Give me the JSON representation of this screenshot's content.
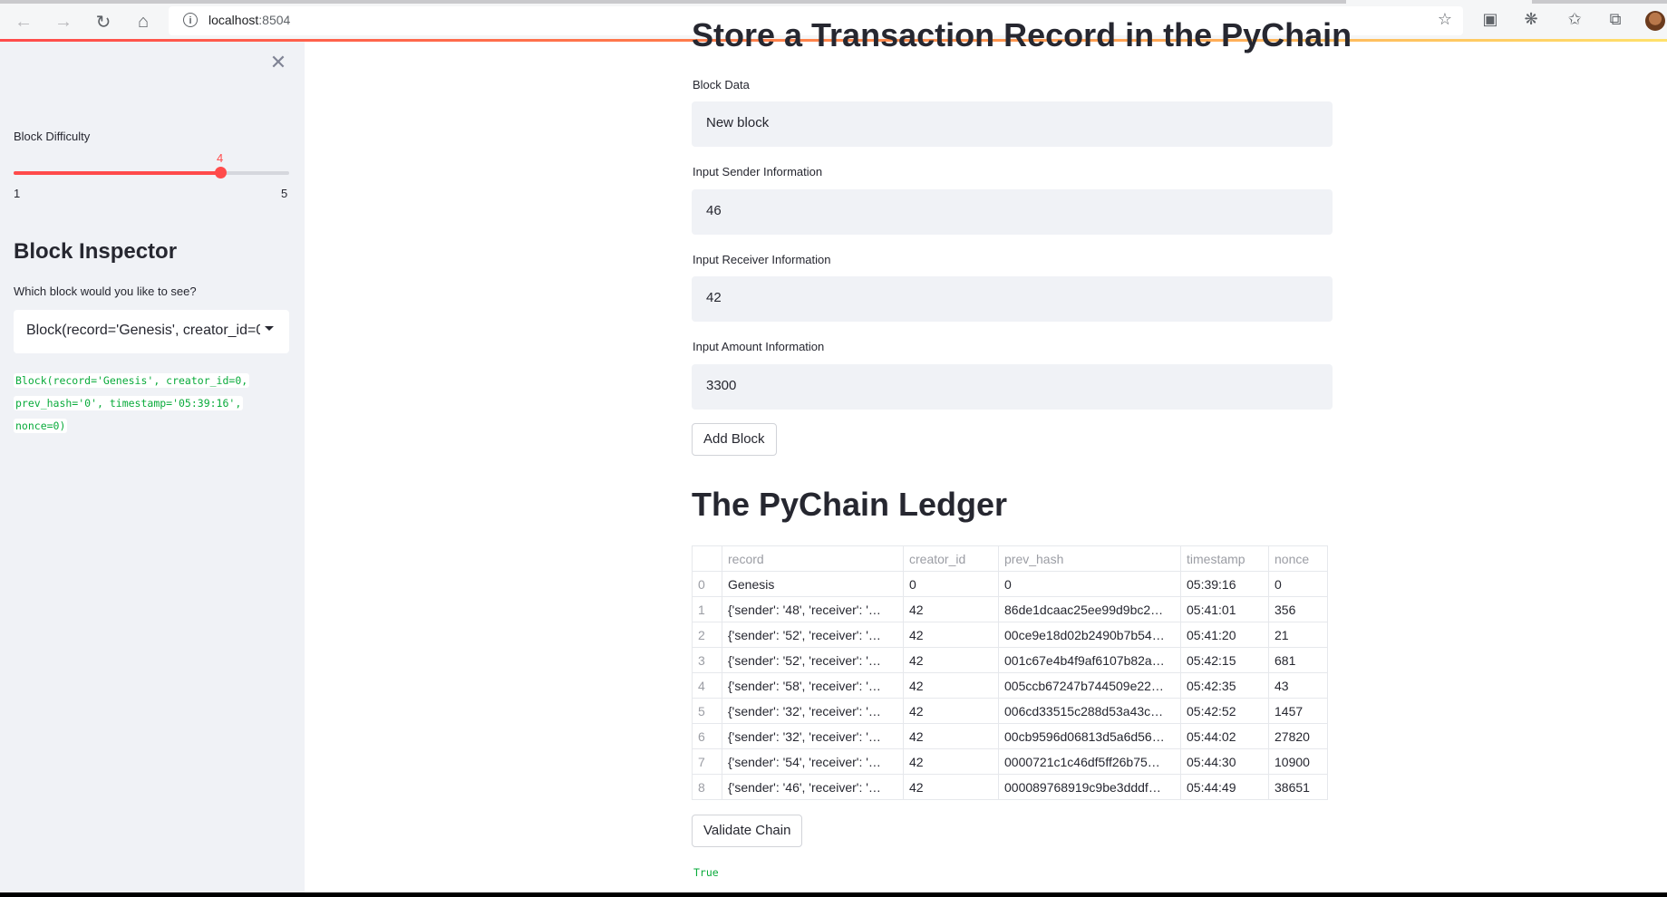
{
  "browser": {
    "url_host": "localhost",
    "url_port": ":8504",
    "icons": [
      "back-arrow-icon",
      "forward-arrow-icon",
      "reload-icon",
      "home-icon",
      "info-icon",
      "favorite-star-icon",
      "extension-icon",
      "puzzle-icon",
      "favorites-icon",
      "collections-icon",
      "profile-avatar"
    ]
  },
  "sidebar": {
    "difficulty_label": "Block Difficulty",
    "difficulty_value": "4",
    "difficulty_min": "1",
    "difficulty_max": "5",
    "difficulty_fraction": 0.75,
    "inspector_title": "Block Inspector",
    "inspector_question": "Which block would you like to see?",
    "selected_block": "Block(record='Genesis', creator_id=0, prev_hash='0', timestamp='05:39:16', nonce=0)",
    "block_code_lines": [
      "Block(record='Genesis', creator_id=0,",
      "prev_hash='0', timestamp='05:39:16',",
      "nonce=0)"
    ]
  },
  "main": {
    "form_title": "Store a Transaction Record in the PyChain",
    "fields": [
      {
        "label": "Block Data",
        "value": "New block"
      },
      {
        "label": "Input Sender Information",
        "value": "46"
      },
      {
        "label": "Input Receiver Information",
        "value": "42"
      },
      {
        "label": "Input Amount Information",
        "value": "3300"
      }
    ],
    "add_block_label": "Add Block",
    "ledger_title": "The PyChain Ledger",
    "ledger": {
      "columns": [
        "",
        "record",
        "creator_id",
        "prev_hash",
        "timestamp",
        "nonce"
      ],
      "rows": [
        [
          "0",
          "Genesis",
          "0",
          "0",
          "05:39:16",
          "0"
        ],
        [
          "1",
          "{'sender': '48', 'receiver': '…",
          "42",
          "86de1dcaac25ee99d9bc2…",
          "05:41:01",
          "356"
        ],
        [
          "2",
          "{'sender': '52', 'receiver': '…",
          "42",
          "00ce9e18d02b2490b7b54…",
          "05:41:20",
          "21"
        ],
        [
          "3",
          "{'sender': '52', 'receiver': '…",
          "42",
          "001c67e4b4f9af6107b82a…",
          "05:42:15",
          "681"
        ],
        [
          "4",
          "{'sender': '58', 'receiver': '…",
          "42",
          "005ccb67247b744509e22…",
          "05:42:35",
          "43"
        ],
        [
          "5",
          "{'sender': '32', 'receiver': '…",
          "42",
          "006cd33515c288d53a43c…",
          "05:42:52",
          "1457"
        ],
        [
          "6",
          "{'sender': '32', 'receiver': '…",
          "42",
          "00cb9596d06813d5a6d56…",
          "05:44:02",
          "27820"
        ],
        [
          "7",
          "{'sender': '54', 'receiver': '…",
          "42",
          "0000721c1c46df5ff26b75…",
          "05:44:30",
          "10900"
        ],
        [
          "8",
          "{'sender': '46', 'receiver': '…",
          "42",
          "000089768919c9be3dddf…",
          "05:44:49",
          "38651"
        ]
      ]
    },
    "validate_label": "Validate Chain",
    "validate_result": "True"
  },
  "colors": {
    "accent": "#ff4b4b",
    "sidebar_bg": "#f0f2f6",
    "code_green": "#09ab3b",
    "text": "#262730"
  }
}
